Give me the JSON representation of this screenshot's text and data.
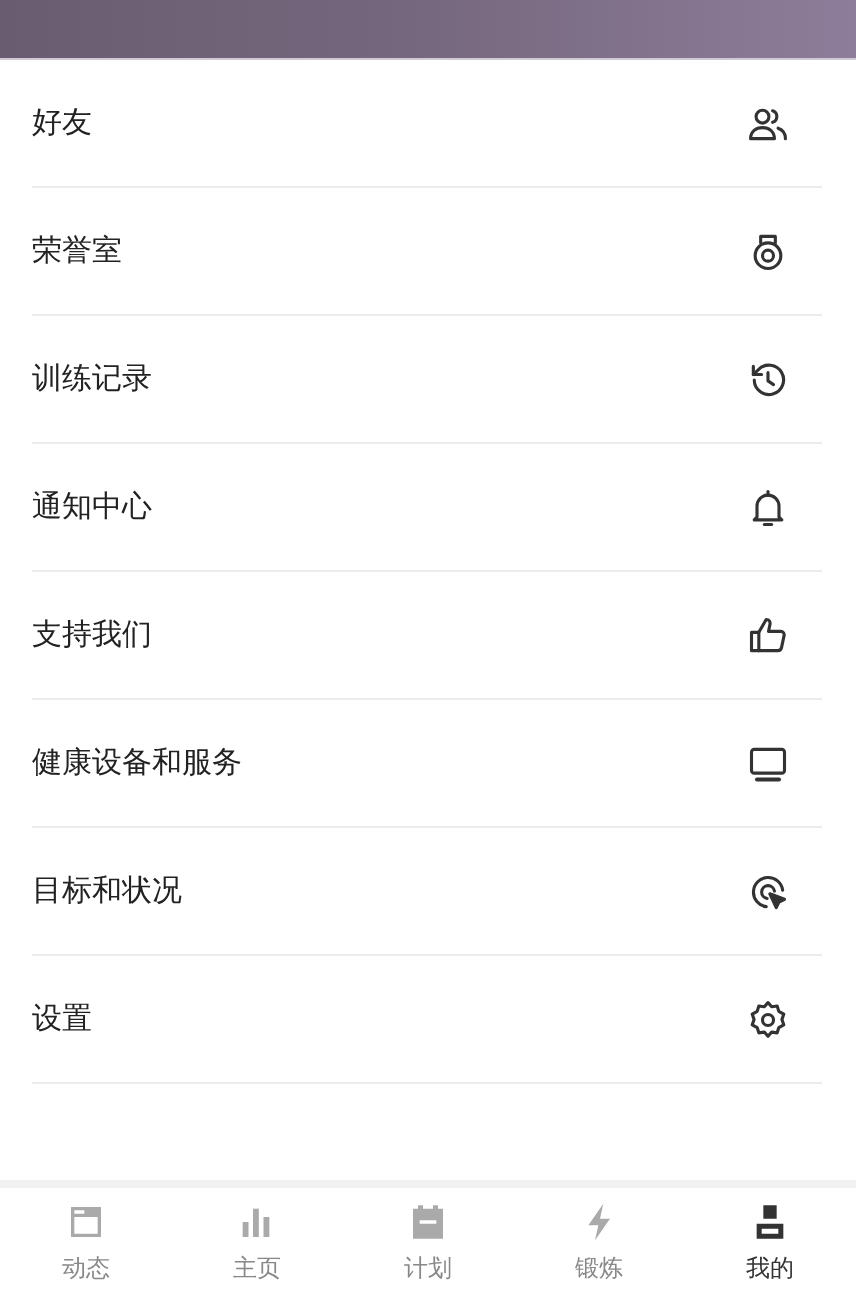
{
  "menu": [
    {
      "label": "好友"
    },
    {
      "label": "荣誉室"
    },
    {
      "label": "训练记录"
    },
    {
      "label": "通知中心"
    },
    {
      "label": "支持我们"
    },
    {
      "label": "健康设备和服务"
    },
    {
      "label": "目标和状况"
    },
    {
      "label": "设置"
    }
  ],
  "bottom_nav": [
    {
      "label": "动态",
      "selected": false
    },
    {
      "label": "主页",
      "selected": false
    },
    {
      "label": "计划",
      "selected": false
    },
    {
      "label": "锻炼",
      "selected": false
    },
    {
      "label": "我的",
      "selected": true
    }
  ]
}
